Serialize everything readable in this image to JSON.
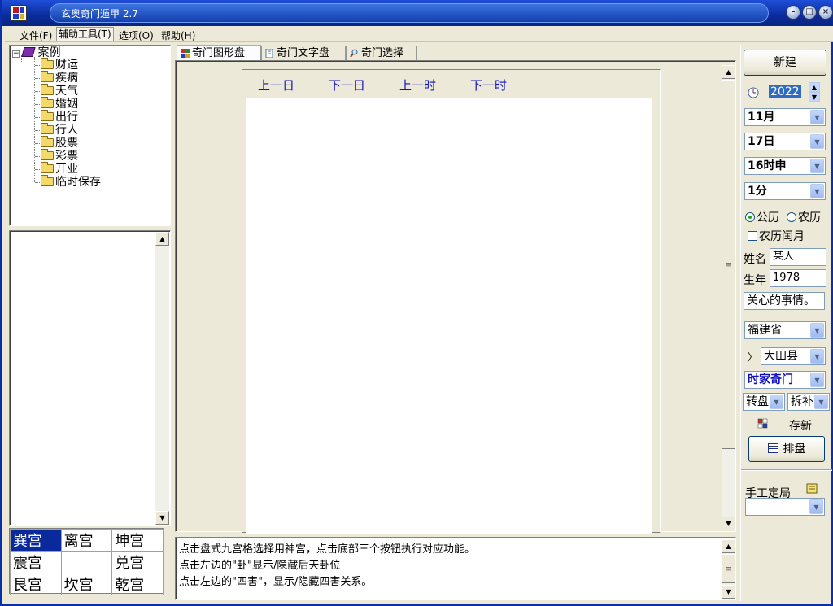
{
  "window": {
    "title": "玄奥奇门遁甲 2.7"
  },
  "menu": {
    "file": "文件(F)",
    "tools": "辅助工具(T)",
    "options": "选项(O)",
    "help": "帮助(H)"
  },
  "tree": {
    "root": "案例",
    "items": [
      "财运",
      "疾病",
      "天气",
      "婚姻",
      "出行",
      "行人",
      "股票",
      "彩票",
      "开业",
      "临时保存"
    ]
  },
  "palaces": {
    "row1": [
      "巽宫",
      "离宫",
      "坤宫"
    ],
    "row2": [
      "震宫",
      "",
      "兑宫"
    ],
    "row3": [
      "艮宫",
      "坎宫",
      "乾宫"
    ],
    "highlighted": "巽宫"
  },
  "tabs": [
    "奇门图形盘",
    "奇门文字盘",
    "奇门选择"
  ],
  "nav": {
    "prev_day": "上一日",
    "next_day": "下一日",
    "prev_hour": "上一时",
    "next_hour": "下一时"
  },
  "info_lines": [
    "点击盘式九宫格选择用神宫，点击底部三个按钮执行对应功能。",
    "点击左边的\"卦\"显示/隐藏后天卦位",
    "点击左边的\"四害\"，显示/隐藏四害关系。"
  ],
  "right": {
    "new_button": "新建",
    "year": "2022",
    "month": "11月",
    "day": "17日",
    "hour": "16时申",
    "minute": "1分",
    "solar": "公历",
    "lunar": "农历",
    "leap": "农历闰月",
    "name_label": "姓名",
    "name_value": "某人",
    "birth_label": "生年",
    "birth_value": "1978",
    "concern": "关心的事情。",
    "province": "福建省",
    "county": "大田县",
    "method": "时家奇门",
    "rotation": "转盘",
    "fill": "拆补",
    "save_new": "存新",
    "arrange_button": "排盘",
    "manual_label": "手工定局",
    "manual_value": ""
  },
  "colors": {
    "title_blue": "#0a2b9c",
    "highlight": "#0a2a9c",
    "nav_text": "#1010c0",
    "method_text": "#1010c0"
  }
}
